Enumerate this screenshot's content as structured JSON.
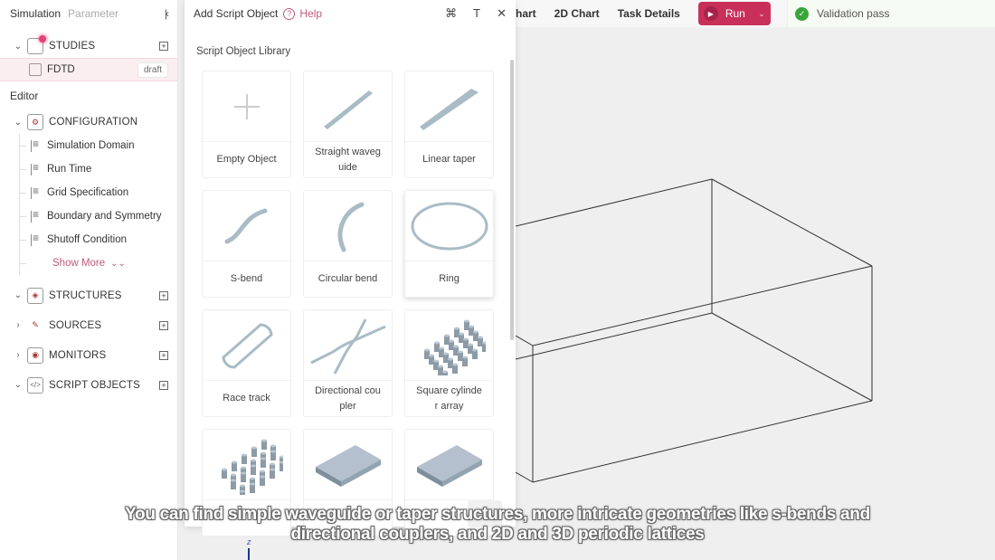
{
  "left_panel": {
    "tabs": [
      "Simulation",
      "Parameter"
    ],
    "collapse_icon": "collapse-left-icon",
    "studies": {
      "label": "STUDIES",
      "items": [
        {
          "label": "FDTD",
          "badge": "draft"
        }
      ]
    },
    "editor_title": "Editor",
    "configuration": {
      "label": "CONFIGURATION",
      "items": [
        "Simulation Domain",
        "Run Time",
        "Grid Specification",
        "Boundary and Symmetry",
        "Shutoff Condition"
      ],
      "show_more": "Show More"
    },
    "categories": [
      {
        "label": "STRUCTURES",
        "expanded": true
      },
      {
        "label": "SOURCES",
        "expanded": false
      },
      {
        "label": "MONITORS",
        "expanded": false
      },
      {
        "label": "SCRIPT OBJECTS",
        "expanded": true
      }
    ]
  },
  "dialog": {
    "title": "Add Script Object",
    "help": "Help",
    "tools": [
      "python-icon",
      "text-icon",
      "close-icon"
    ],
    "library_title": "Script Object Library",
    "items": [
      {
        "label": "Empty Object",
        "icon": "plus-icon"
      },
      {
        "label": "Straight waveg uide",
        "icon": "straight-waveguide-icon"
      },
      {
        "label": "Linear taper",
        "icon": "linear-taper-icon"
      },
      {
        "label": "S-bend",
        "icon": "s-bend-icon"
      },
      {
        "label": "Circular bend",
        "icon": "circular-bend-icon"
      },
      {
        "label": "Ring",
        "icon": "ring-icon"
      },
      {
        "label": "Race track",
        "icon": "race-track-icon"
      },
      {
        "label": "Directional cou pler",
        "icon": "directional-coupler-icon"
      },
      {
        "label": "Square cylinde r array",
        "icon": "square-cylinder-array-icon"
      },
      {
        "label": "",
        "icon": "hex-cylinder-array-icon"
      },
      {
        "label": "",
        "icon": "slab-lattice-icon"
      },
      {
        "label": "",
        "icon": "slab-lattice-icon"
      }
    ]
  },
  "topbar": {
    "tabs": [
      "hart",
      "2D Chart",
      "Task Details"
    ],
    "run_label": "Run",
    "validation": "Validation pass"
  },
  "viewport": {
    "axis_label": "z"
  },
  "caption": {
    "line1": "You can find simple waveguide or taper structures, more intricate geometries like s-bends and",
    "line2": "directional couplers, and 2D and 3D periodic lattices"
  },
  "colors": {
    "accent": "#c8305a",
    "link": "#c05a7a",
    "success": "#3aa53a",
    "shape": "#a9bcc6"
  }
}
